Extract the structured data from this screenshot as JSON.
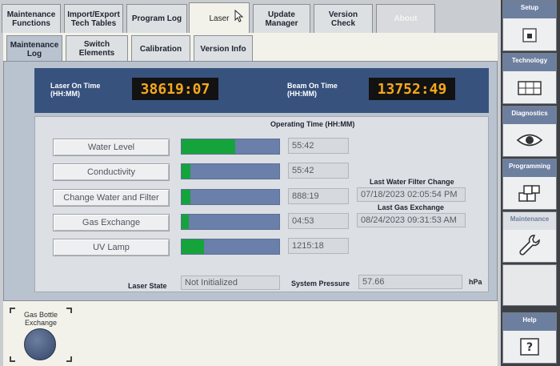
{
  "top_tabs": [
    {
      "label": "Maintenance Functions",
      "state": "normal"
    },
    {
      "label": "Import/Export Tech Tables",
      "state": "normal"
    },
    {
      "label": "Program Log",
      "state": "normal"
    },
    {
      "label": "Laser",
      "state": "active"
    },
    {
      "label": "Update Manager",
      "state": "normal"
    },
    {
      "label": "Version Check",
      "state": "normal"
    },
    {
      "label": "About",
      "state": "disabled"
    }
  ],
  "sub_tabs": [
    {
      "label": "Maintenance Log",
      "state": "active"
    },
    {
      "label": "Switch Elements",
      "state": "normal"
    },
    {
      "label": "Calibration",
      "state": "normal"
    },
    {
      "label": "Version Info",
      "state": "normal"
    }
  ],
  "laser_on_time": {
    "label": "Laser On Time (HH:MM)",
    "value": "38619:07"
  },
  "beam_on_time": {
    "label": "Beam On Time (HH:MM)",
    "value": "13752:49"
  },
  "operating_time_header": "Operating Time (HH:MM)",
  "items": [
    {
      "label": "Water Level",
      "value": "55:42",
      "fill_fraction": 0.55
    },
    {
      "label": "Conductivity",
      "value": "55:42",
      "fill_fraction": 0.09
    },
    {
      "label": "Change Water and Filter",
      "value": "888:19",
      "fill_fraction": 0.09
    },
    {
      "label": "Gas Exchange",
      "value": "04:53",
      "fill_fraction": 0.07
    },
    {
      "label": "UV Lamp",
      "value": "1215:18",
      "fill_fraction": 0.23
    }
  ],
  "last_water_filter_change": {
    "label": "Last Water Filter Change",
    "value": "07/18/2023 02:05:54 PM"
  },
  "last_gas_exchange": {
    "label": "Last Gas Exchange",
    "value": "08/24/2023 09:31:53 AM"
  },
  "laser_state": {
    "label": "Laser State",
    "value": "Not Initialized"
  },
  "system_pressure": {
    "label": "System Pressure",
    "value": "57.66",
    "unit": "hPa"
  },
  "gas_bottle_button": "Gas Bottle Exchange",
  "side_nav": [
    {
      "label": "Setup",
      "icon": "square-icon",
      "state": "normal"
    },
    {
      "label": "Technology",
      "icon": "grid-icon",
      "state": "normal"
    },
    {
      "label": "Diagnostics",
      "icon": "eye-icon",
      "state": "normal"
    },
    {
      "label": "Programming",
      "icon": "blocks-icon",
      "state": "normal"
    },
    {
      "label": "Maintenance",
      "icon": "wrench-icon",
      "state": "active"
    },
    {
      "label": "Help",
      "icon": "question-icon",
      "state": "normal"
    }
  ],
  "colors": {
    "accent_blue": "#38527e",
    "bar_green": "#15a43c",
    "digit_amber": "#f5a81c"
  }
}
